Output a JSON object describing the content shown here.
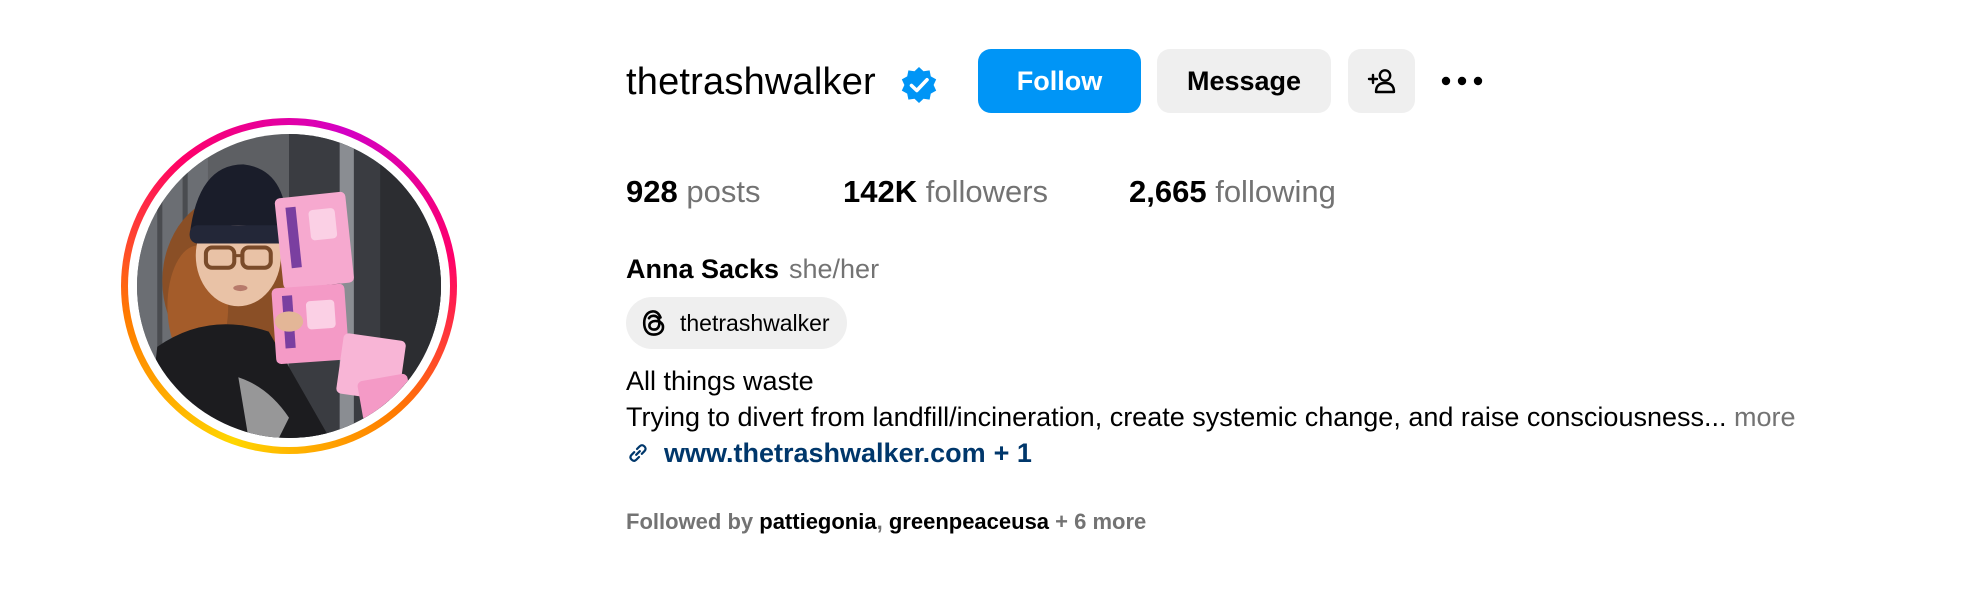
{
  "profile": {
    "username": "thetrashwalker",
    "verified": true,
    "stats": {
      "posts_count": "928",
      "posts_label": "posts",
      "followers_count": "142K",
      "followers_label": "followers",
      "following_count": "2,665",
      "following_label": "following"
    },
    "full_name": "Anna Sacks",
    "pronouns": "she/her",
    "threads_handle": "thetrashwalker",
    "bio_line_1": "All things waste",
    "bio_line_2": "Trying to divert from landfill/incineration, create systemic change, and raise consciousness...",
    "bio_more": "more",
    "link_url": "www.thetrashwalker.com",
    "link_extra": "+ 1",
    "followed_by_prefix": "Followed by",
    "followed_by_accounts": [
      "pattiegonia",
      "greenpeaceusa"
    ],
    "followed_by_more": "+ 6 more"
  },
  "actions": {
    "follow_label": "Follow",
    "message_label": "Message"
  },
  "icons": {
    "verified": "verified-badge-icon",
    "add_user": "add-user-icon",
    "more": "more-options-icon",
    "threads": "threads-icon",
    "link": "link-icon"
  },
  "colors": {
    "follow_button": "#0095f6",
    "secondary_button": "#efefef",
    "muted_text": "#737373",
    "link_text": "#00376b",
    "verified_badge": "#0095f6"
  }
}
